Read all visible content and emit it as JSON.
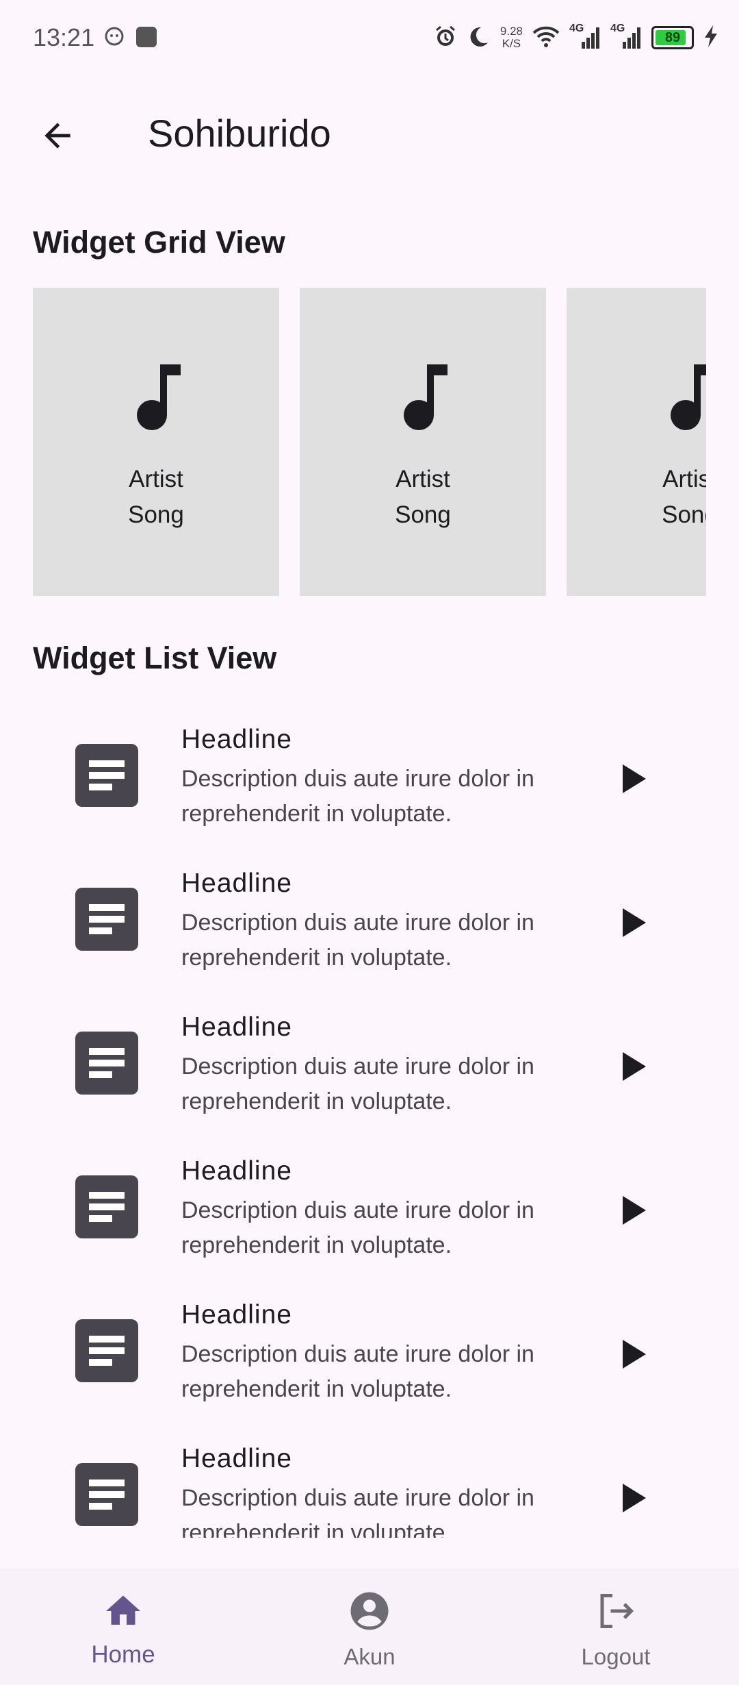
{
  "status_bar": {
    "time": "13:21",
    "net_speed_value": "9.28",
    "net_speed_unit": "K/S",
    "signal_1": "4G",
    "signal_2": "4G",
    "battery": "89"
  },
  "app_bar": {
    "title": "Sohiburido"
  },
  "grid_section": {
    "title": "Widget Grid View",
    "cards": [
      {
        "line1": "Artist",
        "line2": "Song"
      },
      {
        "line1": "Artist",
        "line2": "Song"
      },
      {
        "line1": "Artist",
        "line2": "Song"
      }
    ]
  },
  "list_section": {
    "title": "Widget List View",
    "items": [
      {
        "headline": "Headline",
        "description": "Description duis aute irure dolor in reprehenderit in voluptate."
      },
      {
        "headline": "Headline",
        "description": "Description duis aute irure dolor in reprehenderit in voluptate."
      },
      {
        "headline": "Headline",
        "description": "Description duis aute irure dolor in reprehenderit in voluptate."
      },
      {
        "headline": "Headline",
        "description": "Description duis aute irure dolor in reprehenderit in voluptate."
      },
      {
        "headline": "Headline",
        "description": "Description duis aute irure dolor in reprehenderit in voluptate."
      },
      {
        "headline": "Headline",
        "description": "Description duis aute irure dolor in reprehenderit in voluptate."
      }
    ]
  },
  "bottom_nav": {
    "items": [
      {
        "label": "Home",
        "icon": "home-icon",
        "active": true
      },
      {
        "label": "Akun",
        "icon": "account-circle-icon",
        "active": false
      },
      {
        "label": "Logout",
        "icon": "logout-icon",
        "active": false
      }
    ]
  },
  "colors": {
    "background": "#fdf7fd",
    "accent": "#65558f",
    "card": "#e0e0e0",
    "list_icon_bg": "#49454f"
  }
}
